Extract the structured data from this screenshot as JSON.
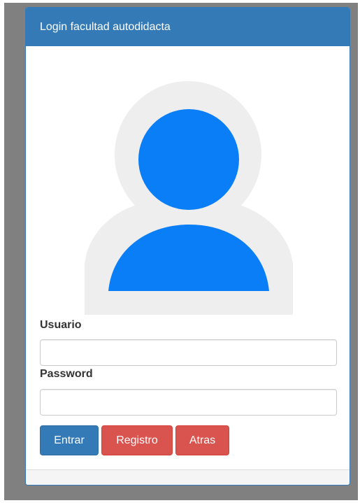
{
  "panel": {
    "title": "Login facultad autodidacta"
  },
  "avatar": {
    "icon": "user-avatar-icon",
    "colors": {
      "figure": "#0a7ef7",
      "background": "#eeeeee"
    }
  },
  "form": {
    "username_label": "Usuario",
    "username_value": "",
    "password_label": "Password",
    "password_value": ""
  },
  "buttons": {
    "entrar": "Entrar",
    "registro": "Registro",
    "atras": "Atras"
  },
  "colors": {
    "primary": "#337ab7",
    "danger": "#d9534f",
    "frame": "#808080"
  }
}
